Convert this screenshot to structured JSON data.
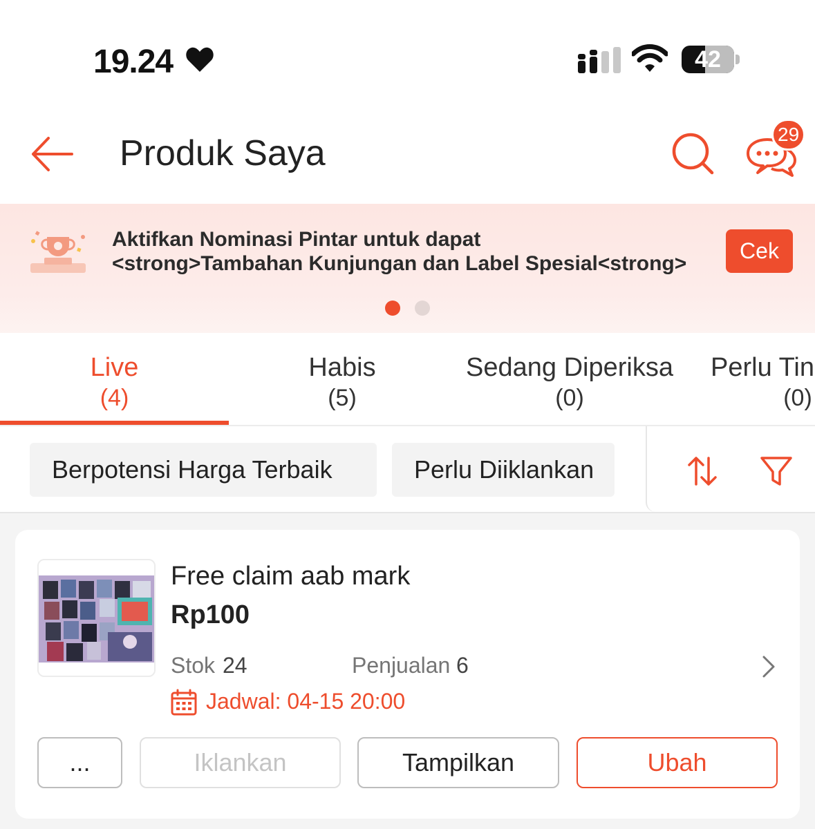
{
  "status_bar": {
    "time": "19.24",
    "battery": "42",
    "icons": [
      "heart-icon",
      "signal-icon",
      "wifi-icon",
      "battery-icon"
    ]
  },
  "header": {
    "title": "Produk Saya",
    "chat_badge": "29",
    "icons": [
      "back-arrow-icon",
      "search-icon",
      "chat-icon"
    ]
  },
  "banner": {
    "line1": "Aktifkan Nominasi Pintar untuk dapat",
    "line2": "<strong>Tambahan Kunjungan dan Label Spesial<strong>",
    "button": "Cek",
    "active_page": 1,
    "page_count": 2
  },
  "tabs": [
    {
      "label": "Live",
      "count": "(4)",
      "active": true
    },
    {
      "label": "Habis",
      "count": "(5)",
      "active": false
    },
    {
      "label": "Sedang Diperiksa",
      "count": "(0)",
      "active": false
    },
    {
      "label": "Perlu Tin",
      "count": "(0)",
      "active": false
    }
  ],
  "filters": {
    "chips": [
      "Berpotensi Harga Terbaik",
      "Perlu Diiklankan"
    ],
    "icons": [
      "sort-icon",
      "filter-funnel-icon"
    ]
  },
  "product": {
    "name": "Free claim aab mark",
    "price": "Rp100",
    "stock_label": "Stok",
    "stock_value": "24",
    "sales_label": "Penjualan",
    "sales_value": "6",
    "schedule": "Jadwal: 04-15 20:00",
    "buttons": {
      "more": "...",
      "advertise": "Iklankan",
      "show": "Tampilkan",
      "edit": "Ubah"
    }
  },
  "colors": {
    "accent": "#ee4d2d",
    "banner_bg": "#fde6e2",
    "page_bg": "#f4f4f4"
  }
}
